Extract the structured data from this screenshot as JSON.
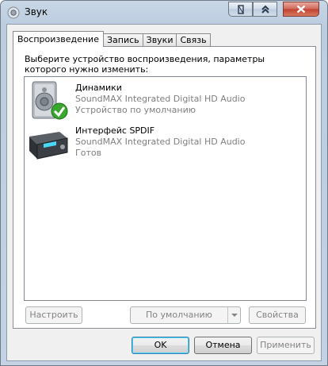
{
  "window": {
    "title": "Звук"
  },
  "tabs": [
    {
      "label": "Воспроизведение",
      "active": true
    },
    {
      "label": "Запись",
      "active": false
    },
    {
      "label": "Звуки",
      "active": false
    },
    {
      "label": "Связь",
      "active": false
    }
  ],
  "playback": {
    "instruction": "Выберите устройство воспроизведения, параметры которого нужно изменить:",
    "devices": [
      {
        "name": "Динамики",
        "driver": "SoundMAX Integrated Digital HD Audio",
        "status": "Устройство по умолчанию",
        "icon": "speaker-icon",
        "default": true
      },
      {
        "name": "Интерфейс SPDIF",
        "driver": "SoundMAX Integrated Digital HD Audio",
        "status": "Готов",
        "icon": "spdif-receiver-icon",
        "default": false
      }
    ],
    "buttons": {
      "configure": "Настроить",
      "set_default": "По умолчанию",
      "properties": "Свойства"
    }
  },
  "dialog_buttons": {
    "ok": "OK",
    "cancel": "Отмена",
    "apply": "Применить"
  }
}
